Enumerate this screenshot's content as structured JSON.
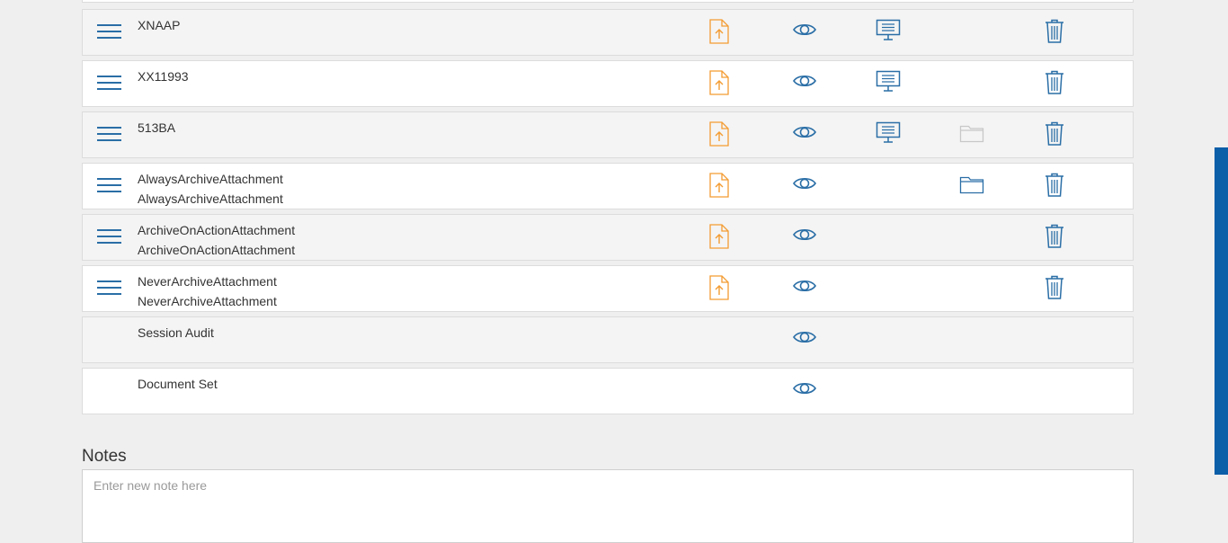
{
  "colors": {
    "accent_blue": "#2a6ea6",
    "upload_orange": "#f39c32",
    "folder_disabled": "#c8c8c8",
    "scrollbar": "#0b5ea8"
  },
  "attachments": [
    {
      "lines": [
        "XNAAP"
      ],
      "has_handle": true,
      "icons": [
        "upload-icon",
        "eye-icon",
        "presentation-icon",
        "delete-icon"
      ]
    },
    {
      "lines": [
        "XX11993"
      ],
      "has_handle": true,
      "icons": [
        "upload-icon",
        "eye-icon",
        "presentation-icon",
        "delete-icon"
      ]
    },
    {
      "lines": [
        "513BA"
      ],
      "has_handle": true,
      "icons": [
        "upload-icon",
        "eye-icon",
        "presentation-icon",
        "folder-icon-disabled",
        "delete-icon"
      ]
    },
    {
      "lines": [
        "AlwaysArchiveAttachment",
        "AlwaysArchiveAttachment"
      ],
      "has_handle": true,
      "icons": [
        "upload-icon",
        "eye-icon",
        "folder-icon",
        "delete-icon"
      ]
    },
    {
      "lines": [
        "ArchiveOnActionAttachment",
        "ArchiveOnActionAttachment"
      ],
      "has_handle": true,
      "icons": [
        "upload-icon",
        "eye-icon",
        "delete-icon"
      ]
    },
    {
      "lines": [
        "NeverArchiveAttachment",
        "NeverArchiveAttachment"
      ],
      "has_handle": true,
      "icons": [
        "upload-icon",
        "eye-icon",
        "delete-icon"
      ]
    },
    {
      "lines": [
        "Session Audit"
      ],
      "has_handle": false,
      "icons": [
        "eye-icon"
      ]
    },
    {
      "lines": [
        "Document Set"
      ],
      "has_handle": false,
      "icons": [
        "eye-icon"
      ]
    }
  ],
  "notes": {
    "title": "Notes",
    "placeholder": "Enter new note here",
    "value": ""
  }
}
